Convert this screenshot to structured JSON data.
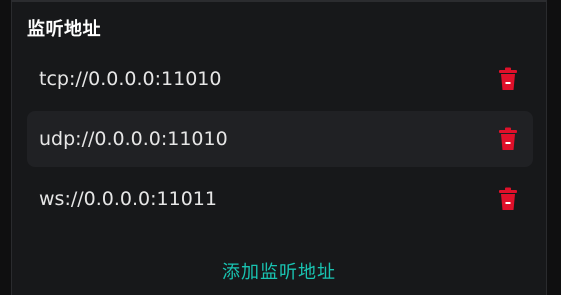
{
  "section": {
    "title": "监听地址"
  },
  "addresses": [
    {
      "value": "tcp://0.0.0.0:11010"
    },
    {
      "value": "udp://0.0.0.0:11010"
    },
    {
      "value": "ws://0.0.0.0:11011"
    }
  ],
  "actions": {
    "add_label": "添加监听地址"
  },
  "colors": {
    "delete_icon": "#e0102a",
    "add_link": "#19c3b1",
    "background": "#17181a",
    "row_highlight": "#202124"
  },
  "icons": {
    "delete": "trash-icon"
  }
}
